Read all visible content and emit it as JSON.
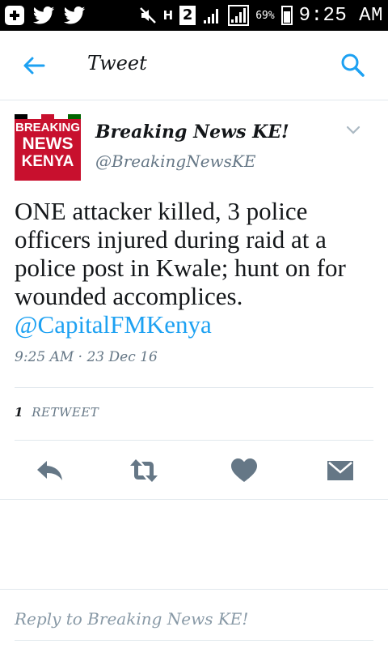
{
  "status_bar": {
    "network_label": "H",
    "sim_label": "2",
    "battery": "69%",
    "time": "9:25 AM",
    "icons": [
      "plus-icon",
      "twitter-bird-icon",
      "twitter-bird-icon",
      "mute-icon",
      "network-h-icon",
      "sim-2-icon",
      "signal-icon",
      "signal-icon",
      "battery-icon"
    ]
  },
  "app_bar": {
    "title": "Tweet",
    "back_icon": "arrow-left-icon",
    "search_icon": "search-icon",
    "accent": "#1da1f2"
  },
  "tweet": {
    "avatar": {
      "line1": "BREAKING",
      "line2": "NEWS",
      "line3": "KENYA",
      "bg": "#c8102e"
    },
    "author_name": "Breaking News KE!",
    "author_handle": "@BreakingNewsKE",
    "text": "ONE attacker killed, 3 police officers injured during raid at a police post in Kwale; hunt on for wounded accomplices.",
    "mention": "@CapitalFMKenya",
    "timestamp": "9:25 AM · 23 Dec 16",
    "retweet_count": "1",
    "retweet_label": "RETWEET"
  },
  "actions": {
    "reply": "reply-icon",
    "retweet": "retweet-icon",
    "like": "heart-icon",
    "message": "envelope-icon",
    "icon_color": "#657786"
  },
  "reply": {
    "placeholder": "Reply to Breaking News KE!"
  }
}
